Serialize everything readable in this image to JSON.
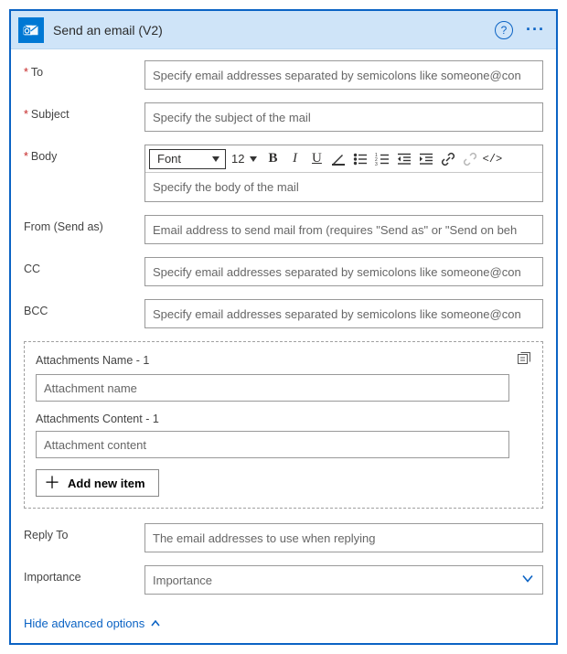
{
  "header": {
    "title": "Send an email (V2)"
  },
  "fields": {
    "to": {
      "label": "To",
      "placeholder": "Specify email addresses separated by semicolons like someone@con"
    },
    "subject": {
      "label": "Subject",
      "placeholder": "Specify the subject of the mail"
    },
    "body": {
      "label": "Body",
      "placeholder": "Specify the body of the mail"
    },
    "from": {
      "label": "From (Send as)",
      "placeholder": "Email address to send mail from (requires \"Send as\" or \"Send on beh"
    },
    "cc": {
      "label": "CC",
      "placeholder": "Specify email addresses separated by semicolons like someone@con"
    },
    "bcc": {
      "label": "BCC",
      "placeholder": "Specify email addresses separated by semicolons like someone@con"
    },
    "replyTo": {
      "label": "Reply To",
      "placeholder": "The email addresses to use when replying"
    },
    "importance": {
      "label": "Importance",
      "placeholder": "Importance"
    }
  },
  "toolbar": {
    "font": "Font",
    "size": "12"
  },
  "attachments": {
    "nameLabel": "Attachments Name - 1",
    "namePlaceholder": "Attachment name",
    "contentLabel": "Attachments Content - 1",
    "contentPlaceholder": "Attachment content",
    "addLabel": "Add new item"
  },
  "footer": {
    "advancedLabel": "Hide advanced options"
  }
}
